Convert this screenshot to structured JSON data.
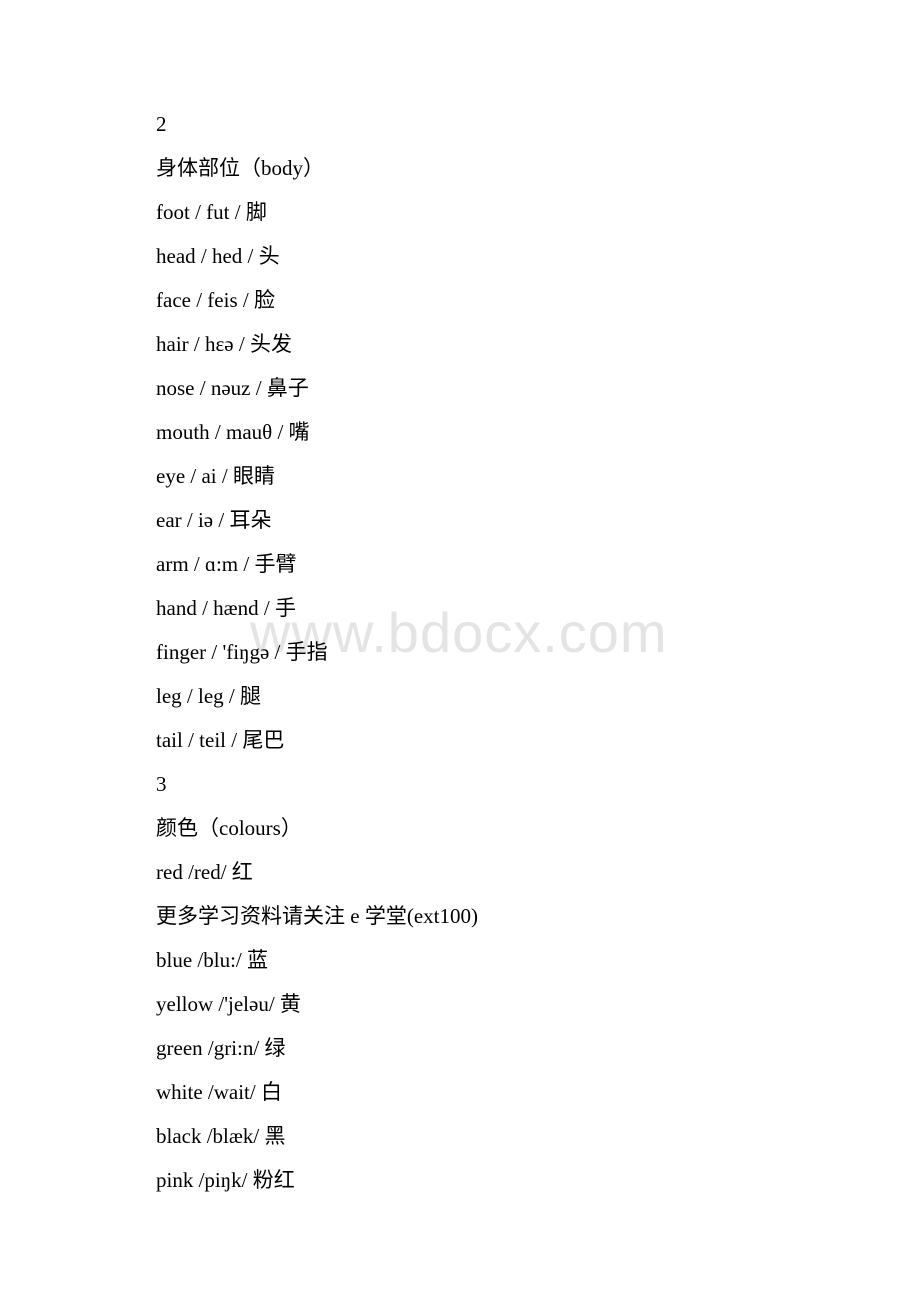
{
  "watermark": "www.bdocx.com",
  "sections": [
    {
      "number": "2",
      "heading": "身体部位（body）",
      "entries": [
        "foot / fut / 脚",
        "head / hed / 头",
        "face / feis / 脸",
        "hair / hɛə / 头发",
        "nose / nəuz / 鼻子",
        "mouth / mauθ / 嘴",
        "eye / ai / 眼睛",
        "ear / iə / 耳朵",
        "arm / ɑ:m / 手臂",
        "hand / hænd / 手",
        "finger / 'fiŋgə / 手指",
        "leg / leg / 腿",
        "tail / teil / 尾巴"
      ]
    },
    {
      "number": "3",
      "heading": "颜色（colours）",
      "entries": [
        "red /red/ 红",
        "更多学习资料请关注 e 学堂(ext100)",
        "blue /blu:/ 蓝",
        "yellow /'jeləu/ 黄",
        "green /gri:n/ 绿",
        "white /wait/ 白",
        "black /blæk/ 黑",
        "pink /piŋk/ 粉红"
      ]
    }
  ]
}
